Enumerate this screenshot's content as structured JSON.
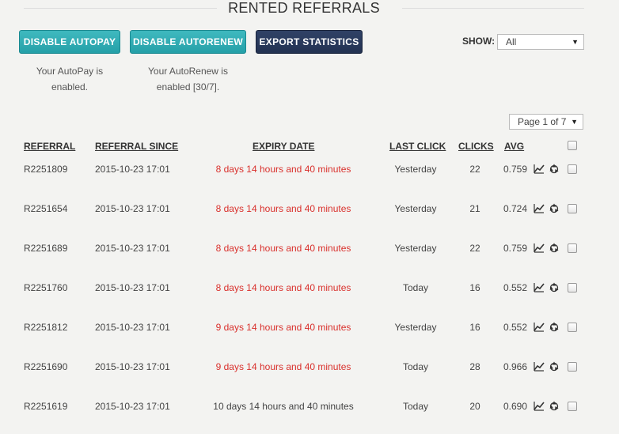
{
  "page": {
    "title": "RENTED REFERRALS"
  },
  "buttons": {
    "disable_autopay": "DISABLE AUTOPAY",
    "disable_autorenew": "DISABLE AUTORENEW",
    "export_statistics": "EXPORT STATISTICS"
  },
  "status": {
    "autopay_line1": "Your AutoPay is",
    "autopay_line2": "enabled.",
    "autorenew_line1": "Your AutoRenew is",
    "autorenew_line2": "enabled [30/7]."
  },
  "filter": {
    "label": "SHOW:",
    "selected": "All"
  },
  "pagination": {
    "selected": "Page 1 of 7"
  },
  "table": {
    "headers": {
      "referral": "REFERRAL",
      "since": "REFERRAL SINCE",
      "expiry": "EXPIRY DATE",
      "last_click": "LAST CLICK",
      "clicks": "CLICKS",
      "avg": "AVG"
    },
    "rows": [
      {
        "referral": "R2251809",
        "since": "2015-10-23 17:01",
        "expiry": "8 days 14 hours and 40 minutes",
        "expiry_urgent": true,
        "last_click": "Yesterday",
        "clicks": "22",
        "avg": "0.759"
      },
      {
        "referral": "R2251654",
        "since": "2015-10-23 17:01",
        "expiry": "8 days 14 hours and 40 minutes",
        "expiry_urgent": true,
        "last_click": "Yesterday",
        "clicks": "21",
        "avg": "0.724"
      },
      {
        "referral": "R2251689",
        "since": "2015-10-23 17:01",
        "expiry": "8 days 14 hours and 40 minutes",
        "expiry_urgent": true,
        "last_click": "Yesterday",
        "clicks": "22",
        "avg": "0.759"
      },
      {
        "referral": "R2251760",
        "since": "2015-10-23 17:01",
        "expiry": "8 days 14 hours and 40 minutes",
        "expiry_urgent": true,
        "last_click": "Today",
        "clicks": "16",
        "avg": "0.552"
      },
      {
        "referral": "R2251812",
        "since": "2015-10-23 17:01",
        "expiry": "9 days 14 hours and 40 minutes",
        "expiry_urgent": true,
        "last_click": "Yesterday",
        "clicks": "16",
        "avg": "0.552"
      },
      {
        "referral": "R2251690",
        "since": "2015-10-23 17:01",
        "expiry": "9 days 14 hours and 40 minutes",
        "expiry_urgent": true,
        "last_click": "Today",
        "clicks": "28",
        "avg": "0.966"
      },
      {
        "referral": "R2251619",
        "since": "2015-10-23 17:01",
        "expiry": "10 days 14 hours and 40 minutes",
        "expiry_urgent": false,
        "last_click": "Today",
        "clicks": "20",
        "avg": "0.690"
      }
    ]
  },
  "icons": {
    "row_chart": "line-chart-icon",
    "row_recycle": "recycle-icon"
  },
  "colors": {
    "teal": "#25a0a8",
    "navy": "#233252",
    "expiry_urgent": "#d9302c",
    "text": "#444444"
  }
}
